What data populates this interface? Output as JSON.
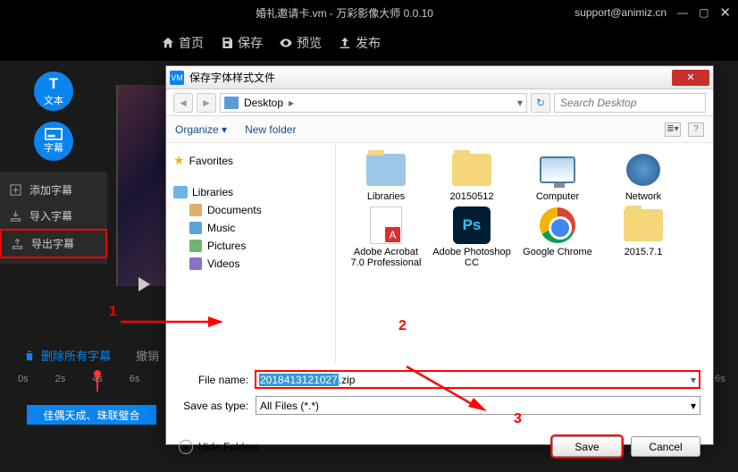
{
  "app": {
    "title": "婚礼邀请卡.vm - 万彩影像大师 0.0.10",
    "support": "support@animiz.cn"
  },
  "toolbar": {
    "home": "首页",
    "save": "保存",
    "preview": "预览",
    "publish": "发布"
  },
  "left": {
    "text": "文本",
    "subtitle": "字幕",
    "text_T": "T",
    "menu": {
      "add": "添加字幕",
      "import": "导入字幕",
      "export": "导出字幕"
    },
    "delete_all": "删除所有字幕",
    "undo": "撤销"
  },
  "timeline": {
    "t0": "0s",
    "t2": "2s",
    "t4": "4s",
    "t6": "6s",
    "tend": "6s"
  },
  "clip": {
    "label": "佳偶天成、珠联璧合"
  },
  "annotations": {
    "a1": "1",
    "a2": "2",
    "a3": "3"
  },
  "dialog": {
    "title": "保存字体样式文件",
    "vm": "VM",
    "path": "Desktop",
    "path_arrow": "▸",
    "search_placeholder": "Search Desktop",
    "organize": "Organize",
    "new_folder": "New folder",
    "tree": {
      "favorites": "Favorites",
      "libraries": "Libraries",
      "documents": "Documents",
      "music": "Music",
      "pictures": "Pictures",
      "videos": "Videos"
    },
    "files": {
      "libraries": "Libraries",
      "f1": "20150512",
      "computer": "Computer",
      "network": "Network",
      "pdf": "Adobe Acrobat 7.0 Professional",
      "ps": "Adobe Photoshop CC",
      "chrome": "Google Chrome",
      "f2": "2015.7.1"
    },
    "filename_label": "File name:",
    "filename_sel": "2018413121027",
    "filename_ext": ".zip",
    "saveas_label": "Save as type:",
    "saveas_value": "All Files (*.*)",
    "hide_folders": "Hide Folders",
    "save": "Save",
    "cancel": "Cancel",
    "help": "?",
    "dd": "▾",
    "refresh": "↻"
  }
}
